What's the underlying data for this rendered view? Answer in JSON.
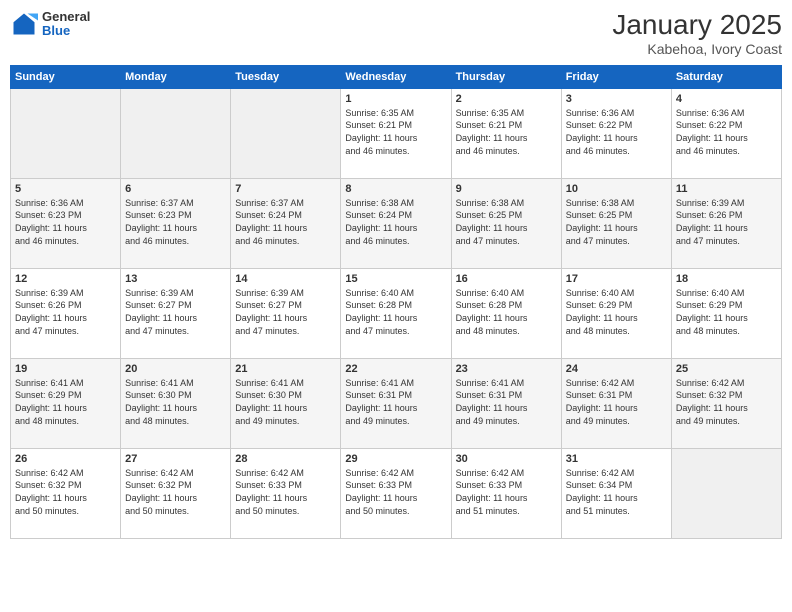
{
  "logo": {
    "general": "General",
    "blue": "Blue"
  },
  "title": "January 2025",
  "location": "Kabehoa, Ivory Coast",
  "weekdays": [
    "Sunday",
    "Monday",
    "Tuesday",
    "Wednesday",
    "Thursday",
    "Friday",
    "Saturday"
  ],
  "weeks": [
    [
      {
        "day": "",
        "info": ""
      },
      {
        "day": "",
        "info": ""
      },
      {
        "day": "",
        "info": ""
      },
      {
        "day": "1",
        "info": "Sunrise: 6:35 AM\nSunset: 6:21 PM\nDaylight: 11 hours\nand 46 minutes."
      },
      {
        "day": "2",
        "info": "Sunrise: 6:35 AM\nSunset: 6:21 PM\nDaylight: 11 hours\nand 46 minutes."
      },
      {
        "day": "3",
        "info": "Sunrise: 6:36 AM\nSunset: 6:22 PM\nDaylight: 11 hours\nand 46 minutes."
      },
      {
        "day": "4",
        "info": "Sunrise: 6:36 AM\nSunset: 6:22 PM\nDaylight: 11 hours\nand 46 minutes."
      }
    ],
    [
      {
        "day": "5",
        "info": "Sunrise: 6:36 AM\nSunset: 6:23 PM\nDaylight: 11 hours\nand 46 minutes."
      },
      {
        "day": "6",
        "info": "Sunrise: 6:37 AM\nSunset: 6:23 PM\nDaylight: 11 hours\nand 46 minutes."
      },
      {
        "day": "7",
        "info": "Sunrise: 6:37 AM\nSunset: 6:24 PM\nDaylight: 11 hours\nand 46 minutes."
      },
      {
        "day": "8",
        "info": "Sunrise: 6:38 AM\nSunset: 6:24 PM\nDaylight: 11 hours\nand 46 minutes."
      },
      {
        "day": "9",
        "info": "Sunrise: 6:38 AM\nSunset: 6:25 PM\nDaylight: 11 hours\nand 47 minutes."
      },
      {
        "day": "10",
        "info": "Sunrise: 6:38 AM\nSunset: 6:25 PM\nDaylight: 11 hours\nand 47 minutes."
      },
      {
        "day": "11",
        "info": "Sunrise: 6:39 AM\nSunset: 6:26 PM\nDaylight: 11 hours\nand 47 minutes."
      }
    ],
    [
      {
        "day": "12",
        "info": "Sunrise: 6:39 AM\nSunset: 6:26 PM\nDaylight: 11 hours\nand 47 minutes."
      },
      {
        "day": "13",
        "info": "Sunrise: 6:39 AM\nSunset: 6:27 PM\nDaylight: 11 hours\nand 47 minutes."
      },
      {
        "day": "14",
        "info": "Sunrise: 6:39 AM\nSunset: 6:27 PM\nDaylight: 11 hours\nand 47 minutes."
      },
      {
        "day": "15",
        "info": "Sunrise: 6:40 AM\nSunset: 6:28 PM\nDaylight: 11 hours\nand 47 minutes."
      },
      {
        "day": "16",
        "info": "Sunrise: 6:40 AM\nSunset: 6:28 PM\nDaylight: 11 hours\nand 48 minutes."
      },
      {
        "day": "17",
        "info": "Sunrise: 6:40 AM\nSunset: 6:29 PM\nDaylight: 11 hours\nand 48 minutes."
      },
      {
        "day": "18",
        "info": "Sunrise: 6:40 AM\nSunset: 6:29 PM\nDaylight: 11 hours\nand 48 minutes."
      }
    ],
    [
      {
        "day": "19",
        "info": "Sunrise: 6:41 AM\nSunset: 6:29 PM\nDaylight: 11 hours\nand 48 minutes."
      },
      {
        "day": "20",
        "info": "Sunrise: 6:41 AM\nSunset: 6:30 PM\nDaylight: 11 hours\nand 48 minutes."
      },
      {
        "day": "21",
        "info": "Sunrise: 6:41 AM\nSunset: 6:30 PM\nDaylight: 11 hours\nand 49 minutes."
      },
      {
        "day": "22",
        "info": "Sunrise: 6:41 AM\nSunset: 6:31 PM\nDaylight: 11 hours\nand 49 minutes."
      },
      {
        "day": "23",
        "info": "Sunrise: 6:41 AM\nSunset: 6:31 PM\nDaylight: 11 hours\nand 49 minutes."
      },
      {
        "day": "24",
        "info": "Sunrise: 6:42 AM\nSunset: 6:31 PM\nDaylight: 11 hours\nand 49 minutes."
      },
      {
        "day": "25",
        "info": "Sunrise: 6:42 AM\nSunset: 6:32 PM\nDaylight: 11 hours\nand 49 minutes."
      }
    ],
    [
      {
        "day": "26",
        "info": "Sunrise: 6:42 AM\nSunset: 6:32 PM\nDaylight: 11 hours\nand 50 minutes."
      },
      {
        "day": "27",
        "info": "Sunrise: 6:42 AM\nSunset: 6:32 PM\nDaylight: 11 hours\nand 50 minutes."
      },
      {
        "day": "28",
        "info": "Sunrise: 6:42 AM\nSunset: 6:33 PM\nDaylight: 11 hours\nand 50 minutes."
      },
      {
        "day": "29",
        "info": "Sunrise: 6:42 AM\nSunset: 6:33 PM\nDaylight: 11 hours\nand 50 minutes."
      },
      {
        "day": "30",
        "info": "Sunrise: 6:42 AM\nSunset: 6:33 PM\nDaylight: 11 hours\nand 51 minutes."
      },
      {
        "day": "31",
        "info": "Sunrise: 6:42 AM\nSunset: 6:34 PM\nDaylight: 11 hours\nand 51 minutes."
      },
      {
        "day": "",
        "info": ""
      }
    ]
  ]
}
